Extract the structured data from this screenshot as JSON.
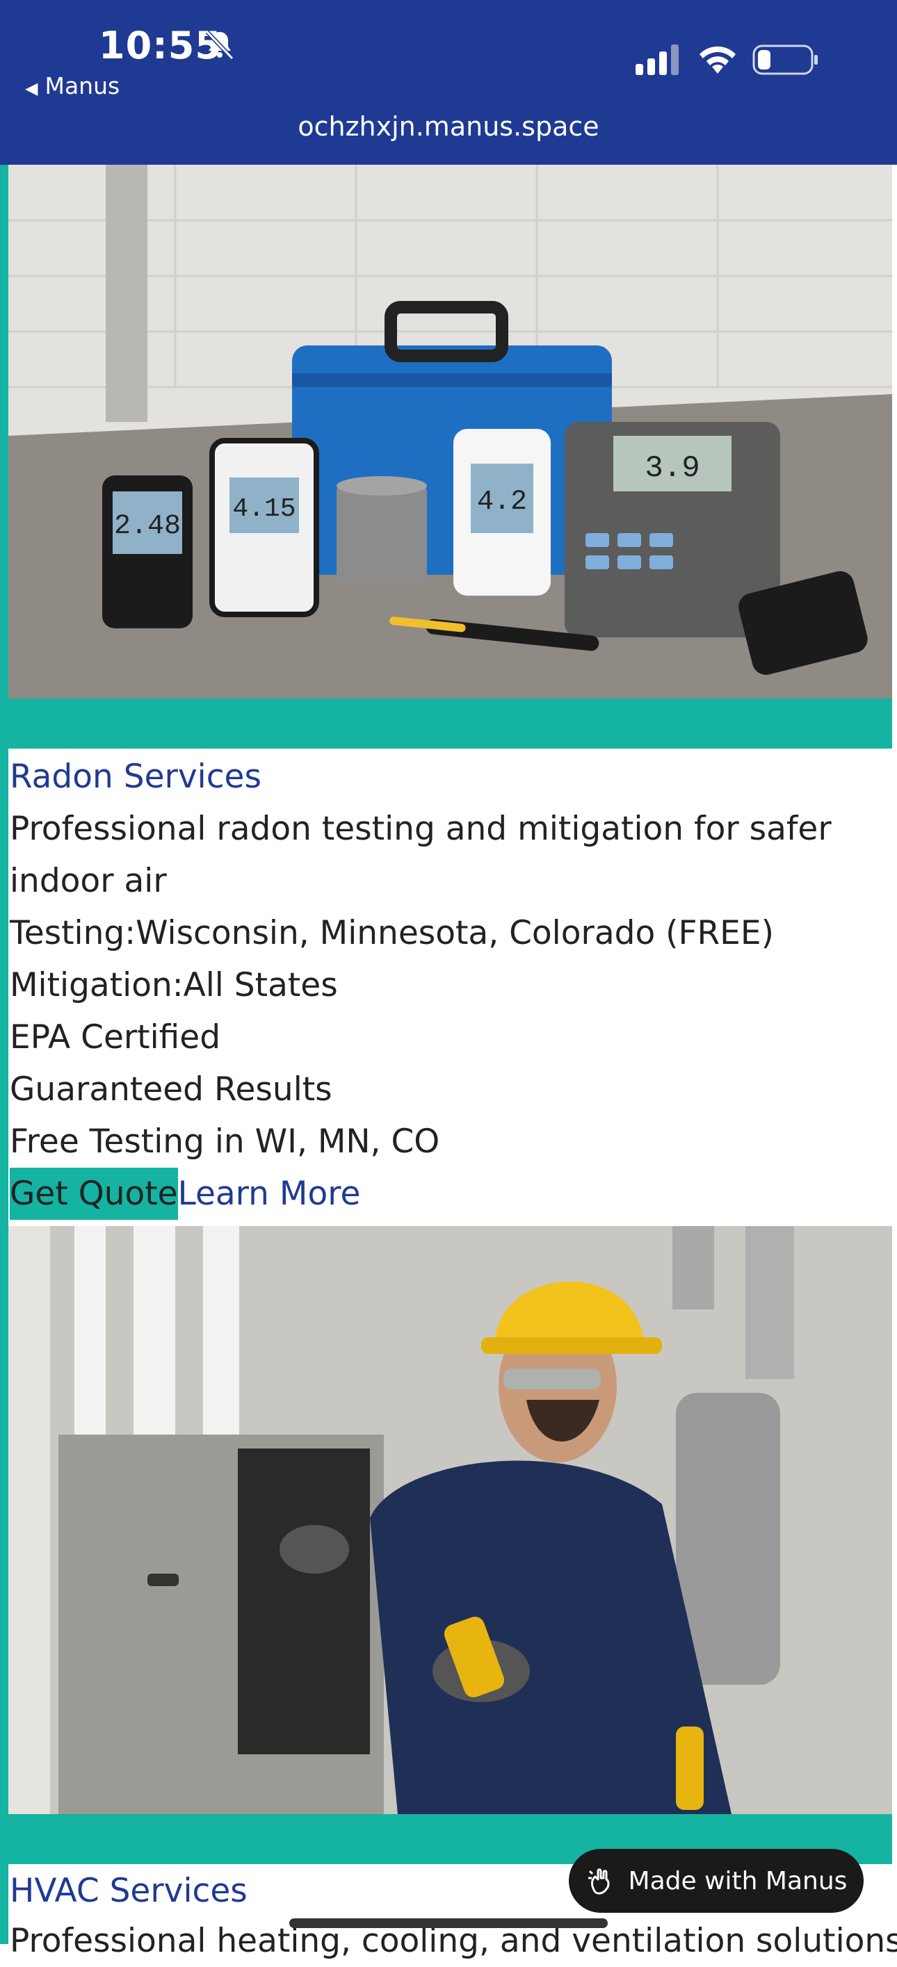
{
  "status_bar": {
    "time": "10:55",
    "back_label": "Manus"
  },
  "browser": {
    "url": "ochzhxjn.manus.space"
  },
  "radon": {
    "image_meter_readings": [
      "2.48",
      "4.15",
      "4.2",
      "3.9"
    ],
    "title": "Radon Services",
    "description": "Professional radon testing and mitigation for safer indoor air",
    "features": [
      "Testing:Wisconsin, Minnesota, Colorado (FREE)",
      "Mitigation:All States",
      "EPA Certified",
      "Guaranteed Results",
      "Free Testing in WI, MN, CO"
    ],
    "cta_quote": "Get Quote",
    "cta_learn": "Learn More"
  },
  "hvac": {
    "title": "HVAC Services",
    "description": "Professional heating, cooling, and ventilation solutions"
  },
  "badge": {
    "label": "Made with Manus"
  },
  "colors": {
    "brand_blue": "#1f3a93",
    "accent_teal": "#14b3a2"
  }
}
